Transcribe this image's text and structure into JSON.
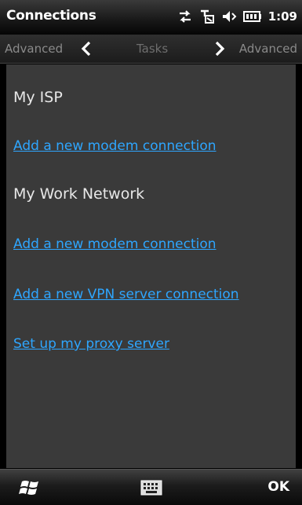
{
  "window": {
    "title": "Connections",
    "clock": "1:09"
  },
  "status_icons": [
    "data-sync-icon",
    "signal-icon",
    "volume-icon",
    "battery-icon"
  ],
  "tabs": {
    "left": "Advanced",
    "center": "Tasks",
    "right": "Advanced"
  },
  "groups": [
    {
      "header": "My ISP",
      "links": [
        "Add a new modem connection"
      ]
    },
    {
      "header": "My Work Network",
      "links": [
        "Add a new modem connection",
        "Add a new VPN server connection",
        "Set up my proxy server"
      ]
    }
  ],
  "softkeys": {
    "left_icon": "windows-start-icon",
    "center_icon": "keyboard-icon",
    "right": "OK"
  },
  "colors": {
    "link": "#2ea6ff",
    "content_bg": "#3a3a3a",
    "header_text": "#e8e8e8"
  }
}
